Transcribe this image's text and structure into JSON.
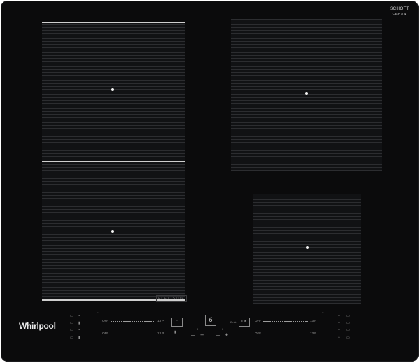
{
  "brand": {
    "logo": "Whirlpool",
    "glass_line1": "SCHOTT",
    "glass_line2": "CERAN"
  },
  "flexiside_label": "FLEXISIDE",
  "controls": {
    "left_top": {
      "off_label": "OFF",
      "max_label": "13 P"
    },
    "left_bottom": {
      "off_label": "OFF",
      "max_label": "13 P"
    },
    "right_top": {
      "off_label": "OFF",
      "max_label": "13 P"
    },
    "right_bottom": {
      "off_label": "OFF",
      "max_label": "13 P"
    },
    "sixth_sense_label": "6",
    "ok_label": "OK",
    "minus": "–",
    "plus": "+",
    "timer_label": "0",
    "timer_small": "2 min"
  },
  "icons": {
    "left_column": [
      "pot-icon",
      "pot-icon",
      "pot-icon",
      "pot-icon"
    ],
    "right_column": [
      "pot-icon",
      "pot-icon",
      "pot-icon",
      "pot-icon"
    ]
  }
}
